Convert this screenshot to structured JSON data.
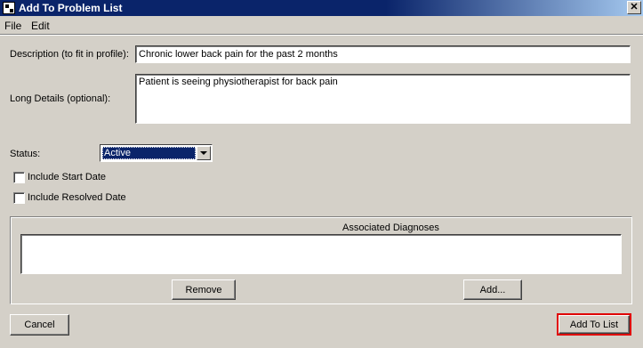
{
  "window": {
    "title": "Add To Problem List",
    "close_glyph": "✕"
  },
  "menu": [
    "File",
    "Edit"
  ],
  "form": {
    "description_label": "Description (to fit in profile):",
    "description_value": "Chronic lower back pain for the past 2 months",
    "long_details_label": "Long Details (optional):",
    "long_details_value": "Patient is seeing physiotherapist for back pain",
    "status_label": "Status:",
    "status_value": "Active",
    "include_start_date_label": "Include Start Date",
    "include_start_date_checked": false,
    "include_resolved_date_label": "Include Resolved Date",
    "include_resolved_date_checked": false
  },
  "diagnoses": {
    "title": "Associated Diagnoses",
    "items": [],
    "remove_label": "Remove",
    "add_label": "Add..."
  },
  "footer": {
    "cancel_label": "Cancel",
    "add_to_list_label": "Add To List"
  },
  "colors": {
    "title_bar": "#0a246a",
    "window_bg": "#d4d0c8",
    "selection": "#0a246a",
    "highlight_border": "#e00000"
  }
}
